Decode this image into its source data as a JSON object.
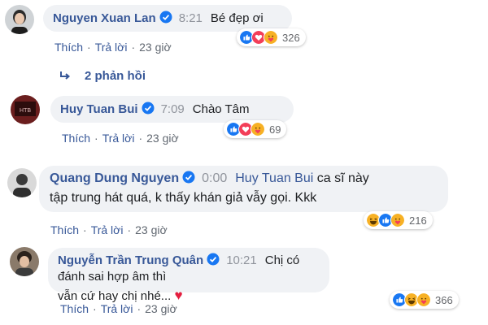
{
  "comments": [
    {
      "author": "Nguyen Xuan Lan",
      "timestamp": "8:21",
      "text": "Bé đẹp ơi",
      "actions": {
        "like": "Thích",
        "reply": "Trả lời",
        "time": "23 giờ"
      },
      "reactions": {
        "icons": [
          "like-icon",
          "love-icon",
          "care-icon"
        ],
        "count": "326"
      }
    },
    {
      "author": "Huy Tuan Bui",
      "timestamp": "7:09",
      "text": "Chào Tâm",
      "actions": {
        "like": "Thích",
        "reply": "Trả lời",
        "time": "23 giờ"
      },
      "reactions": {
        "icons": [
          "like-icon",
          "love-icon",
          "care-icon"
        ],
        "count": "69"
      }
    },
    {
      "author": "Quang Dung Nguyen",
      "timestamp": "0:00",
      "mention": "Huy Tuan Bui",
      "text_line1": "ca sĩ này",
      "text_line2": "tập trung hát quá, k thấy khán giả vẫy gọi. Kkk",
      "actions": {
        "like": "Thích",
        "reply": "Trả lời",
        "time": "23 giờ"
      },
      "reactions": {
        "icons": [
          "haha-icon",
          "like-icon",
          "care-icon"
        ],
        "count": "216"
      }
    },
    {
      "author": "Nguyễn Trần Trung Quân",
      "timestamp": "10:21",
      "text_line1": "Chị có đánh sai hợp âm thì",
      "text_line2": "vẫn cứ hay chị nhé...",
      "heart": "♥",
      "actions": {
        "like": "Thích",
        "reply": "Trả lời",
        "time": "23 giờ"
      },
      "reactions": {
        "icons": [
          "like-icon",
          "haha-icon",
          "care-icon"
        ],
        "count": "366"
      }
    }
  ],
  "replies_link": "2 phản hồi",
  "colors": {
    "link": "#385898",
    "bubble": "#f0f2f5",
    "like": "#1877f2",
    "love": "#f33e58",
    "care": "#f7b125"
  }
}
